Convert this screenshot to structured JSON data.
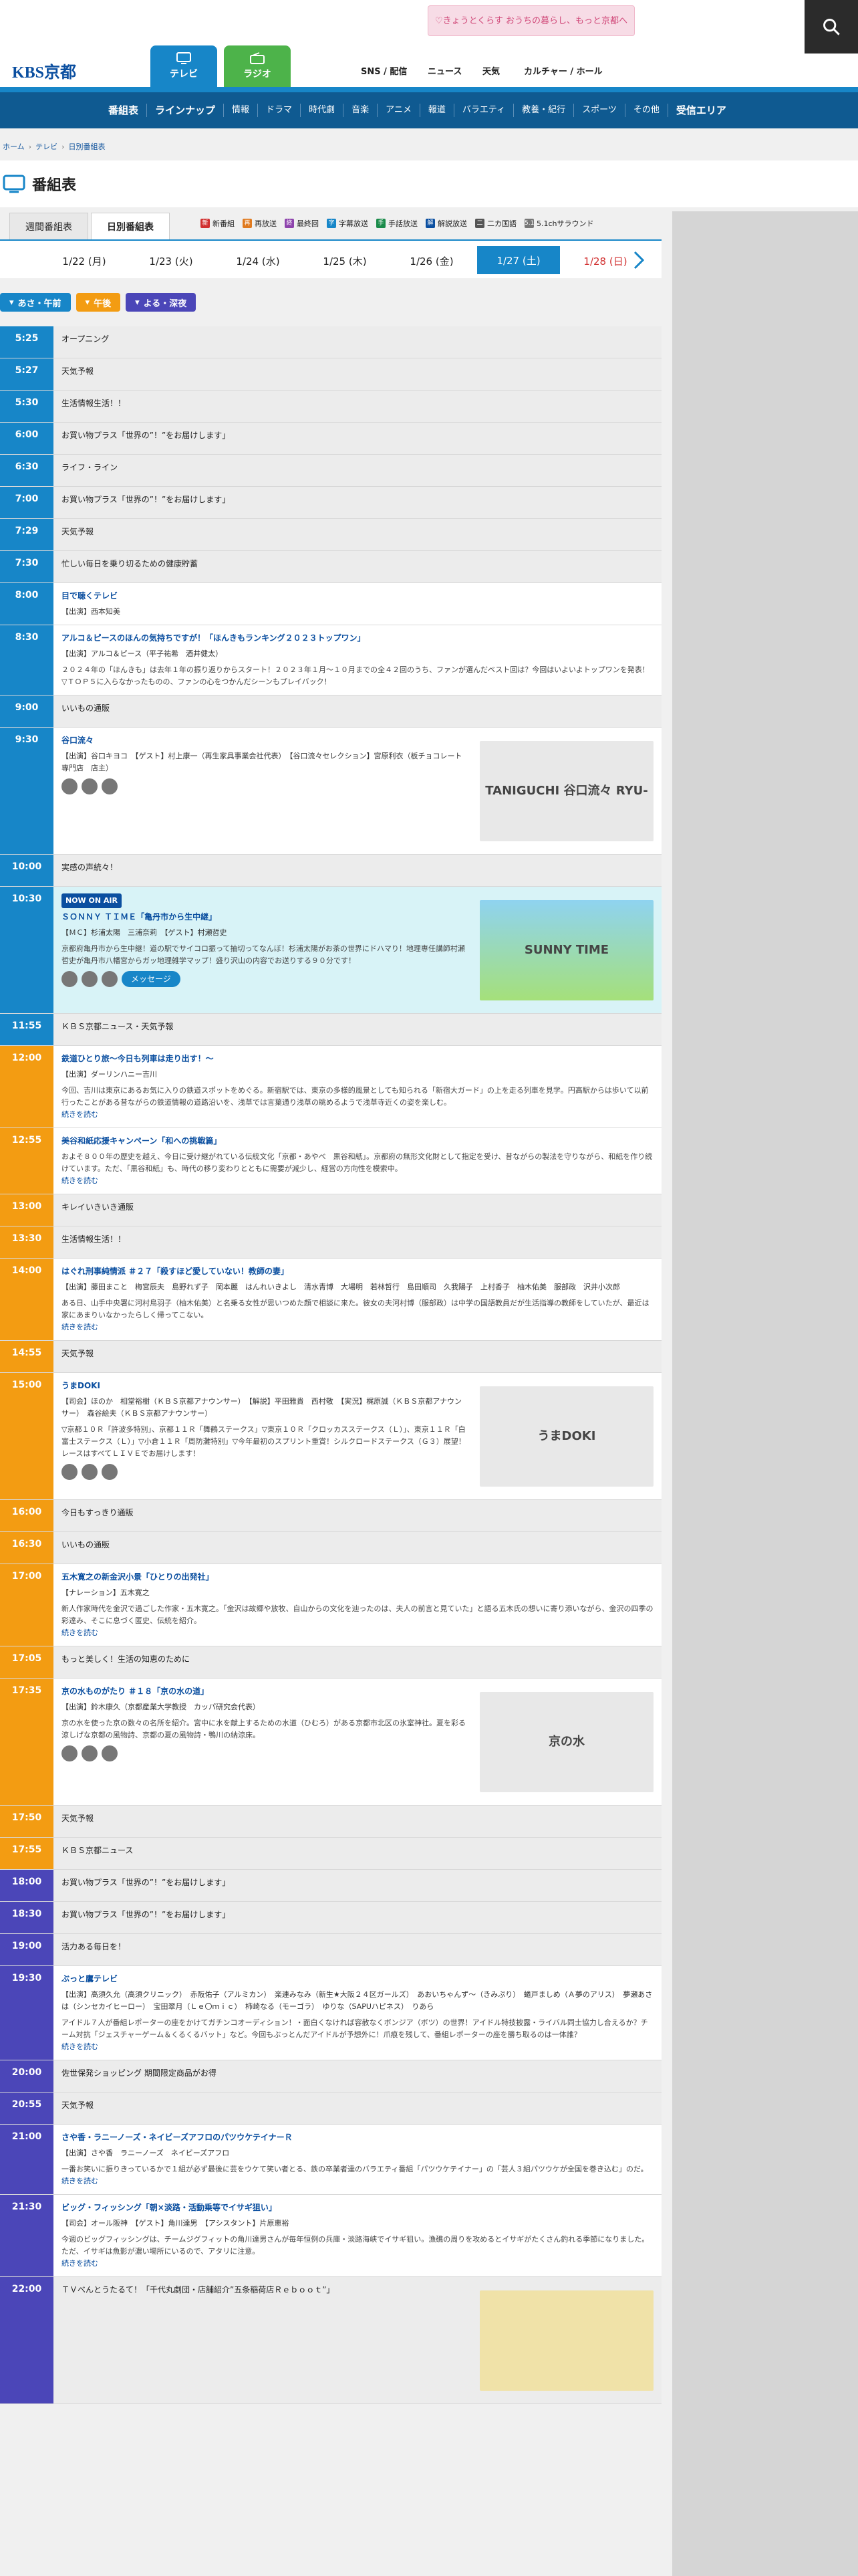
{
  "header": {
    "promo_text": "♡きょうとくらす おうちの暮らし、もっと京都へ",
    "logo_text": "KBS京都",
    "channel_tabs": [
      {
        "label": "テレビ"
      },
      {
        "label": "ラジオ"
      }
    ],
    "utility_links": [
      "SNS / 配信",
      "ニュース",
      "天気",
      "カルチャー / ホール"
    ],
    "colors": {
      "tv": "#1786c8",
      "radio": "#4db34a",
      "nav": "#0f5a91"
    }
  },
  "nav": {
    "items": [
      "番組表",
      "ラインナップ",
      "情報",
      "ドラマ",
      "時代劇",
      "音楽",
      "アニメ",
      "報道",
      "バラエティ",
      "教養・紀行",
      "スポーツ",
      "その他",
      "受信エリア"
    ]
  },
  "breadcrumb": [
    "ホーム",
    "テレビ",
    "日別番組表"
  ],
  "page": {
    "title": "番組表"
  },
  "view_tabs": [
    "週間番組表",
    "日別番組表"
  ],
  "legend": [
    {
      "mark": "新",
      "label": "新番組",
      "color": "#d13030"
    },
    {
      "mark": "再",
      "label": "再放送",
      "color": "#e07a1f"
    },
    {
      "mark": "終",
      "label": "最終回",
      "color": "#8e44ad"
    },
    {
      "mark": "字",
      "label": "字幕放送",
      "color": "#1786c8"
    },
    {
      "mark": "手",
      "label": "手話放送",
      "color": "#1a8b4a"
    },
    {
      "mark": "解",
      "label": "解説放送",
      "color": "#0b4fa0"
    },
    {
      "mark": "二",
      "label": "二カ国語",
      "color": "#555555"
    },
    {
      "mark": "5.1",
      "label": "5.1chサラウンド",
      "color": "#777777"
    }
  ],
  "dates": [
    {
      "label": "1/22 (月)"
    },
    {
      "label": "1/23 (火)"
    },
    {
      "label": "1/24 (水)"
    },
    {
      "label": "1/25 (木)"
    },
    {
      "label": "1/26 (金)"
    },
    {
      "label": "1/27 (土)",
      "selected": true
    },
    {
      "label": "1/28 (日)",
      "sunday": true
    }
  ],
  "periods": [
    {
      "label": "あさ・午前",
      "color": "#1786c8"
    },
    {
      "label": "午後",
      "color": "#f39c12"
    },
    {
      "label": "よる・深夜",
      "color": "#4b46b8"
    }
  ],
  "schedule": [
    {
      "time": "5:25",
      "title": "オープニング",
      "period": "morning"
    },
    {
      "time": "5:27",
      "title": "天気予報",
      "period": "morning"
    },
    {
      "time": "5:30",
      "title": "生活情報生活！！",
      "period": "morning"
    },
    {
      "time": "6:00",
      "title": "お買い物プラス「世界の”！”をお届けします」",
      "period": "morning"
    },
    {
      "time": "6:30",
      "title": "ライフ・ライン",
      "period": "morning"
    },
    {
      "time": "7:00",
      "title": "お買い物プラス「世界の”！”をお届けします」",
      "period": "morning"
    },
    {
      "time": "7:29",
      "title": "天気予報",
      "period": "morning"
    },
    {
      "time": "7:30",
      "title": "忙しい毎日を乗り切るための健康貯蓄",
      "period": "morning"
    },
    {
      "time": "8:00",
      "title": "目で聴くテレビ",
      "note": "【出演】西本知美",
      "period": "morning"
    },
    {
      "time": "8:30",
      "title": "アルコ＆ピースのほんの気持ちですが！「ほんきもランキング２０２３トップワン」",
      "note": "【出演】アルコ＆ピース（平子祐希　酒井健太）",
      "desc": "２０２４年の「ほんきも」は去年１年の振り返りからスタート！２０２３年１月〜１０月までの全４２回のうち、ファンが選んだベスト回は？今回はいよいよトップワンを発表！▽ＴＯＰ５に入らなかったものの、ファンの心をつかんだシーンもプレイバック！",
      "period": "morning"
    },
    {
      "time": "9:00",
      "title": "いいもの通販",
      "period": "morning"
    },
    {
      "time": "9:30",
      "title": "谷口流々",
      "note": "【出演】谷口キヨコ　【ゲスト】村上康一（再生家具事業会社代表）　【谷口流々セレクション】宮原利衣（板チョコレート専門店　店主）",
      "thumb": "TANIGUCHI 谷口流々 RYU-RYU",
      "period": "morning",
      "sns": true
    },
    {
      "time": "10:00",
      "title": "実感の声統々！",
      "period": "morning"
    },
    {
      "time": "10:30",
      "title": "ＳＯＮＮＹ ＴＩＭＥ「亀丹市から生中継」",
      "badge": "NOW ON AIR",
      "note": "【ＭＣ】杉浦太陽　三浦奈莉　【ゲスト】村瀬哲史",
      "desc": "京都府亀丹市から生中継！道の駅でサイコロ振って抽切ってなんぼ！杉浦太陽がお茶の世界にドハマり！地理専任講師村瀬哲史が亀丹市八幡宮からガッ地理雑学マップ！盛り沢山の内容でお送りする９０分です！",
      "thumb": "SUNNY TIME",
      "period": "morning",
      "onair": true,
      "sns": true,
      "message_label": "メッセージ"
    },
    {
      "time": "11:55",
      "title": "ＫＢＳ京都ニュース・天気予報",
      "period": "morning"
    },
    {
      "time": "12:00",
      "title": "鉄道ひとり旅〜今日も列車は走り出す！〜",
      "note": "【出演】ダーリンハニー吉川",
      "desc": "今回、吉川は東京にあるお気に入りの鉄道スポットをめぐる。新宿駅では、東京の多様的風景としても知られる「新宿大ガード」の上を走る列車を見学。円高駅からは歩いて以前行ったことがある昔ながらの鉄道情報の道路沿いを、浅草では言葉通り浅草の眺めるようで浅草寺近くの姿を楽しむ。",
      "more": "続きを読む",
      "period": "afternoon"
    },
    {
      "time": "12:55",
      "title": "美谷和紙応援キャンペーン「和への挑戦篇」",
      "desc": "およそ８００年の歴史を越え、今日に受け継がれている伝統文化「京都・あやべ　黒谷和紙」。京都府の無形文化財として指定を受け、昔ながらの製法を守りながら、和紙を作り続けています。ただ、「黒谷和紙」も、時代の移り変わりとともに需要が減少し、経営の方向性を模索中。",
      "more": "続きを読む",
      "period": "afternoon"
    },
    {
      "time": "13:00",
      "title": "キレイいきいき通販",
      "period": "afternoon"
    },
    {
      "time": "13:30",
      "title": "生活情報生活！！",
      "period": "afternoon"
    },
    {
      "time": "14:00",
      "title": "はぐれ刑事純情派 ＃２７「殺すほど愛していない！教師の妻」",
      "note": "【出演】藤田まこと　梅宮辰夫　島野れず子　岡本麗　はんれいきよし　清水青博　大場明　若林哲行　島田順司　久我陽子　上村香子　柚木佑美　服部政　沢井小次郎",
      "desc": "ある日、山手中央署に河村鳥羽子（柚木佑美）と名乗る女性が思いつめた顔で相談に来た。彼女の夫河村博（服部政）は中学の国語教員だが生活指導の教師をしていたが、最近は家にあまりいなかったらしく帰ってこない。",
      "more": "続きを読む",
      "period": "afternoon"
    },
    {
      "time": "14:55",
      "title": "天気予報",
      "period": "afternoon"
    },
    {
      "time": "15:00",
      "title": "うまDOKI",
      "note": "【司会】ほのか　相堂裕樹（ＫＢＳ京都アナウンサー）　【解説】平田雅貴　西村敬　【実況】梶原誠（ＫＢＳ京都アナウンサー）　森谷絵夫（ＫＢＳ京都アナウンサー）",
      "desc": "▽京都１０Ｒ「許波多特別」、京都１１Ｒ「舞鶴ステークス」▽東京１０Ｒ「クロッカスステークス（Ｌ）」、東京１１Ｒ「白富士ステークス（Ｌ）」▽小倉１１Ｒ「周防灘特別」▽今年最初のスプリント重賞！シルクロードステークス（Ｇ３）展望！レースはすべてＬＩＶＥでお届けします！",
      "thumb": "うまDOKI",
      "period": "afternoon",
      "sns": true
    },
    {
      "time": "16:00",
      "title": "今日もすっきり通販",
      "period": "afternoon"
    },
    {
      "time": "16:30",
      "title": "いいもの通販",
      "period": "afternoon"
    },
    {
      "time": "17:00",
      "title": "五木寛之の新金沢小景「ひとりの出発社」",
      "note": "【ナレーション】五木寛之",
      "desc": "新人作家時代を金沢で過ごした作家・五木寛之。「金沢は故郷や放牧、自山からの文化を辿ったのは、夫人の前言と見ていた」と語る五木氏の想いに寄り添いながら、金沢の四季の彩達み、そこに息づく匿史、伝統を紹介。",
      "more": "続きを読む",
      "period": "afternoon"
    },
    {
      "time": "17:05",
      "title": "もっと美しく！生活の知恵のために",
      "period": "afternoon"
    },
    {
      "time": "17:35",
      "title": "京の水ものがたり ＃１８「京の水の道」",
      "note": "【出演】鈴木康久（京都産業大学教授　カッパ研究会代表）",
      "desc": "京の水を使った京の数々の名所を紹介。宮中に水を献上するための水道（ひむろ）がある京都市北区の氷室神社。夏を彩る涼しげな京都の風物詩、京都の夏の風物詩・鴨川の納涼床。",
      "thumb": "京の水",
      "period": "afternoon",
      "sns": true
    },
    {
      "time": "17:50",
      "title": "天気予報",
      "period": "afternoon"
    },
    {
      "time": "17:55",
      "title": "ＫＢＳ京都ニュース",
      "period": "afternoon"
    },
    {
      "time": "18:00",
      "title": "お買い物プラス「世界の”！”をお届けします」",
      "period": "evening"
    },
    {
      "time": "18:30",
      "title": "お買い物プラス「世界の”！”をお届けします」",
      "period": "evening"
    },
    {
      "time": "19:00",
      "title": "活力ある毎日を！",
      "period": "evening"
    },
    {
      "time": "19:30",
      "title": "ぶっと鷹テレビ",
      "note": "【出演】高須久允（高須クリニック）　赤阪佑子（アルミカン）　楽連みなみ（新生★大阪２４区ガールズ）　あおいちゃんず〜（きみぷり）　蜷戸ましめ（Ａ夢のアリス）　夢瀬あさは（シンセカイヒーロー）　宝田翠月（Ｌｅ〇ｍｉｃ）　柿崎なる（モーゴラ）　ゆりな（SAPUハピネス）　りあら",
      "desc": "アイドル７人が番組レポーターの座をかけてガチンコオーディション！・面白くなければ容赦なくボンジア（ボツ）の世界！アイドル特技披露・ライバル同士協力し合えるか？チーム対抗「ジェスチャーゲーム＆くるくるバット」など。今回もぶっとんだアイドルが予想外に！爪痕を残して、番組レポーターの座を勝ち取るのは一体誰？",
      "more": "続きを読む",
      "period": "evening"
    },
    {
      "time": "20:00",
      "title": "佐世保発ショッピング 期間限定商品がお得",
      "period": "evening"
    },
    {
      "time": "20:55",
      "title": "天気予報",
      "period": "evening"
    },
    {
      "time": "21:00",
      "title": "さや香・ラニーノーズ・ネイビーズアフロのパツウケテイナーＲ",
      "note": "【出演】さや香　ラニーノーズ　ネイビーズアフロ",
      "desc": "一番お笑いに振りきっているかで１組が必ず最後に芸をウケて笑い者とる、鉄の卒業者達のバラエティ番組「パツウケテイナー」の「芸人３組パツウケが全国を巻き込む」のだ。",
      "more": "続きを読む",
      "period": "evening"
    },
    {
      "time": "21:30",
      "title": "ビッグ・フィッシング「朝×淡路・活動乗等でイサギ狙い」",
      "note": "【司会】オール阪神　【ゲスト】角川達男　【アシスタント】片原恵裕",
      "desc": "今週のビッグフィッシングは、チームジグフィットの角川達男さんが毎年恒例の兵庫・淡路海峡でイサギ狙い。漁礁の周りを攻めるとイサギがたくさん釣れる季節になりました。ただ、イサギは魚影が濃い場所にいるので、アタリに注意。",
      "more": "続きを読む",
      "period": "evening"
    },
    {
      "time": "22:00",
      "title": "ＴＶべんとうたるて！「千代丸劇団・店舗紹介”五条稲荷店Ｒｅｂｏｏｔ”」",
      "thumb": "",
      "period": "evening"
    }
  ]
}
